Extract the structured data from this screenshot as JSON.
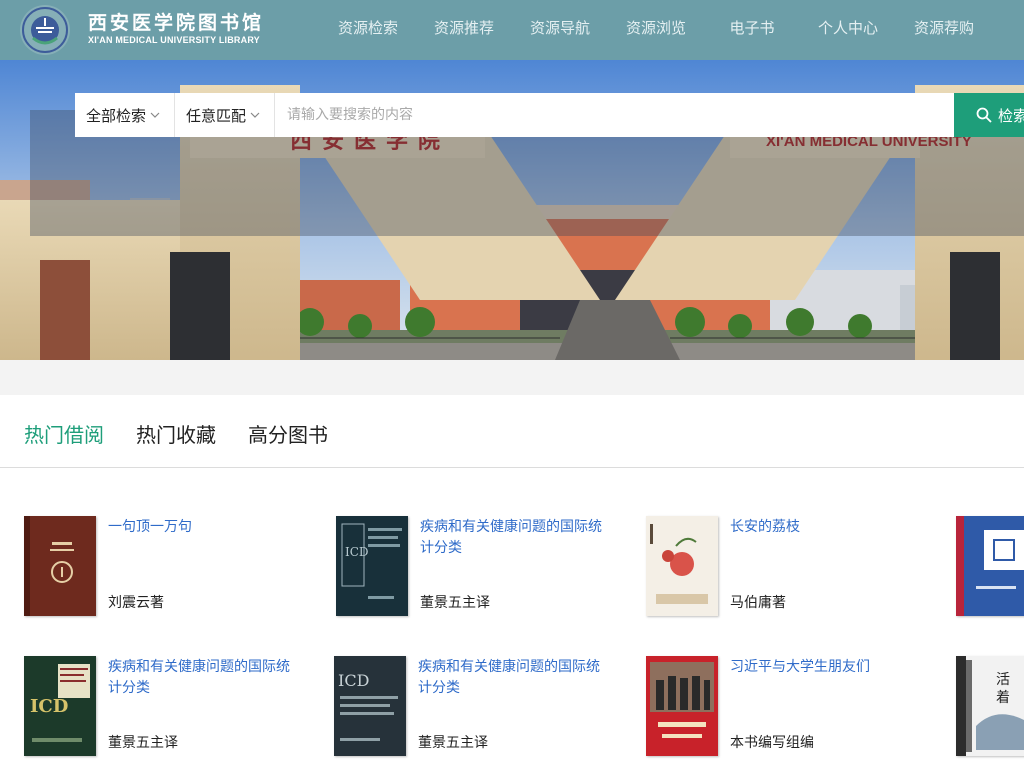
{
  "header": {
    "library_name": "西安医学院图书馆",
    "library_name_en": "XI'AN MEDICAL UNIVERSITY LIBRARY",
    "logo_icon": "library-seal-logo",
    "nav": [
      {
        "label": "资源检索"
      },
      {
        "label": "资源推荐"
      },
      {
        "label": "资源导航"
      },
      {
        "label": "资源浏览"
      },
      {
        "label": "电子书"
      },
      {
        "label": "个人中心"
      },
      {
        "label": "资源荐购"
      }
    ]
  },
  "banner": {
    "gate_sign_cn": "西安医学院",
    "gate_sign_en": "XI'AN MEDICAL UNIVERSITY"
  },
  "search": {
    "scope_value": "全部检索",
    "match_value": "任意匹配",
    "placeholder": "请输入要搜索的内容",
    "button_label": "检索",
    "button_icon": "search-icon",
    "dropdown_icon": "chevron-down-icon"
  },
  "tabs": [
    {
      "label": "热门借阅",
      "active": true
    },
    {
      "label": "热门收藏",
      "active": false
    },
    {
      "label": "高分图书",
      "active": false
    }
  ],
  "books": [
    {
      "title": "一句顶一万句",
      "author": "刘震云著"
    },
    {
      "title": "疾病和有关健康问题的国际统计分类",
      "author": "董景五主译"
    },
    {
      "title": "长安的荔枝",
      "author": "马伯庸著"
    },
    {
      "title": "",
      "author": ""
    },
    {
      "title": "疾病和有关健康问题的国际统计分类",
      "author": "董景五主译"
    },
    {
      "title": "疾病和有关健康问题的国际统计分类",
      "author": "董景五主译"
    },
    {
      "title": "习近平与大学生朋友们",
      "author": "本书编写组编"
    },
    {
      "title": "",
      "author": ""
    }
  ],
  "colors": {
    "header_bg": "#6c9ea8",
    "accent": "#1e9e7a",
    "link": "#2f6bc9"
  }
}
